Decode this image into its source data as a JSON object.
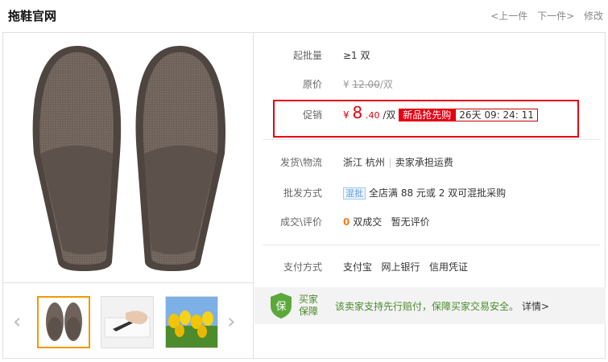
{
  "title": "拖鞋官网",
  "nav": {
    "prev": "<上一件",
    "next": "下一件>",
    "edit": "修改"
  },
  "gallery": {
    "left_arrow": "‹",
    "right_arrow": "›"
  },
  "rows": {
    "moq": {
      "label": "起批量",
      "value": "≥1 双"
    },
    "original": {
      "label": "原价",
      "currency": "¥",
      "price": "12.00",
      "unit": "/双"
    },
    "promo": {
      "label": "促销",
      "currency": "¥",
      "price_int": "8",
      "price_dec": ".40",
      "unit": "/双",
      "badge": "新品抢先购",
      "countdown": "26天 09: 24: 11"
    },
    "shipping": {
      "label": "发货\\物流",
      "origin": "浙江 杭州",
      "fee": "卖家承担运费"
    },
    "wholesale": {
      "label": "批发方式",
      "tag": "混批",
      "desc": "全店满 88 元或 2 双可混批采购"
    },
    "reviews": {
      "label": "成交\\评价",
      "count": "0",
      "count_label": "双成交",
      "review": "暂无评价"
    },
    "payment": {
      "label": "支付方式",
      "methods": [
        "支付宝",
        "网上银行",
        "信用凭证"
      ]
    }
  },
  "guarantee": {
    "icon_char": "保",
    "title_line1": "买家",
    "title_line2": "保障",
    "desc": "该卖家支持先行赔付，保障买家交易安全。",
    "more": "详情>"
  },
  "colors": {
    "accent_red": "#e60012",
    "guarantee_green": "#4a8a2c",
    "highlight_orange": "#f37b1d"
  }
}
